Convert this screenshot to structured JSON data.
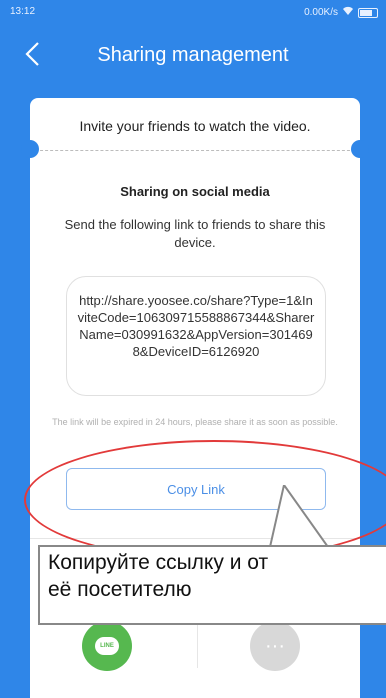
{
  "status": {
    "time": "13:12",
    "network_speed": "0.00K/s"
  },
  "header": {
    "title": "Sharing management"
  },
  "card": {
    "invite_text": "Invite your friends to watch the video.",
    "section_title": "Sharing on social media",
    "description": "Send the following link to friends to share this device.",
    "link": "http://share.yoosee.co/share?Type=1&InviteCode=106309715588867344&SharerName=030991632&AppVersion=3014698&DeviceID=6126920",
    "expiry_note": "The link will be expired in 24 hours, please share it as soon as possible.",
    "copy_button": "Copy Link"
  },
  "share_apps": [
    {
      "icon": "line-icon",
      "label": "LINE"
    },
    {
      "icon": "more-icon",
      "label": "···"
    }
  ],
  "annotation": {
    "callout_text": "Копируйте ссылку и от\nеё посетителю",
    "highlight_color": "#e23a3a"
  },
  "colors": {
    "background": "#2f86e8",
    "accent": "#4b8fe6",
    "line_green": "#56b84f"
  }
}
